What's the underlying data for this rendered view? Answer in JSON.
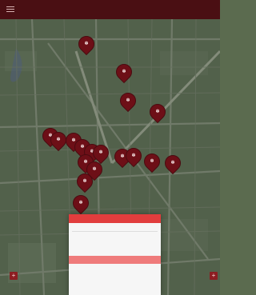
{
  "topbar": {
    "logo": "",
    "right_link": ""
  },
  "sheet": {
    "tabs": [
      "",
      ""
    ],
    "field_value": "",
    "options": [
      "",
      "",
      "",
      "",
      "",
      ""
    ],
    "selected_index": 3
  },
  "side_buttons": {
    "left": "+",
    "right": "+"
  },
  "map_credit": "",
  "colors": {
    "topbar": "#4a0f13",
    "marker": "#6d0f17",
    "accent": "#e13d3d",
    "selected": "#ef7b7b"
  },
  "icons": {
    "menu": "menu-icon",
    "marker": "map-marker-icon",
    "zoom": "plus-icon"
  }
}
